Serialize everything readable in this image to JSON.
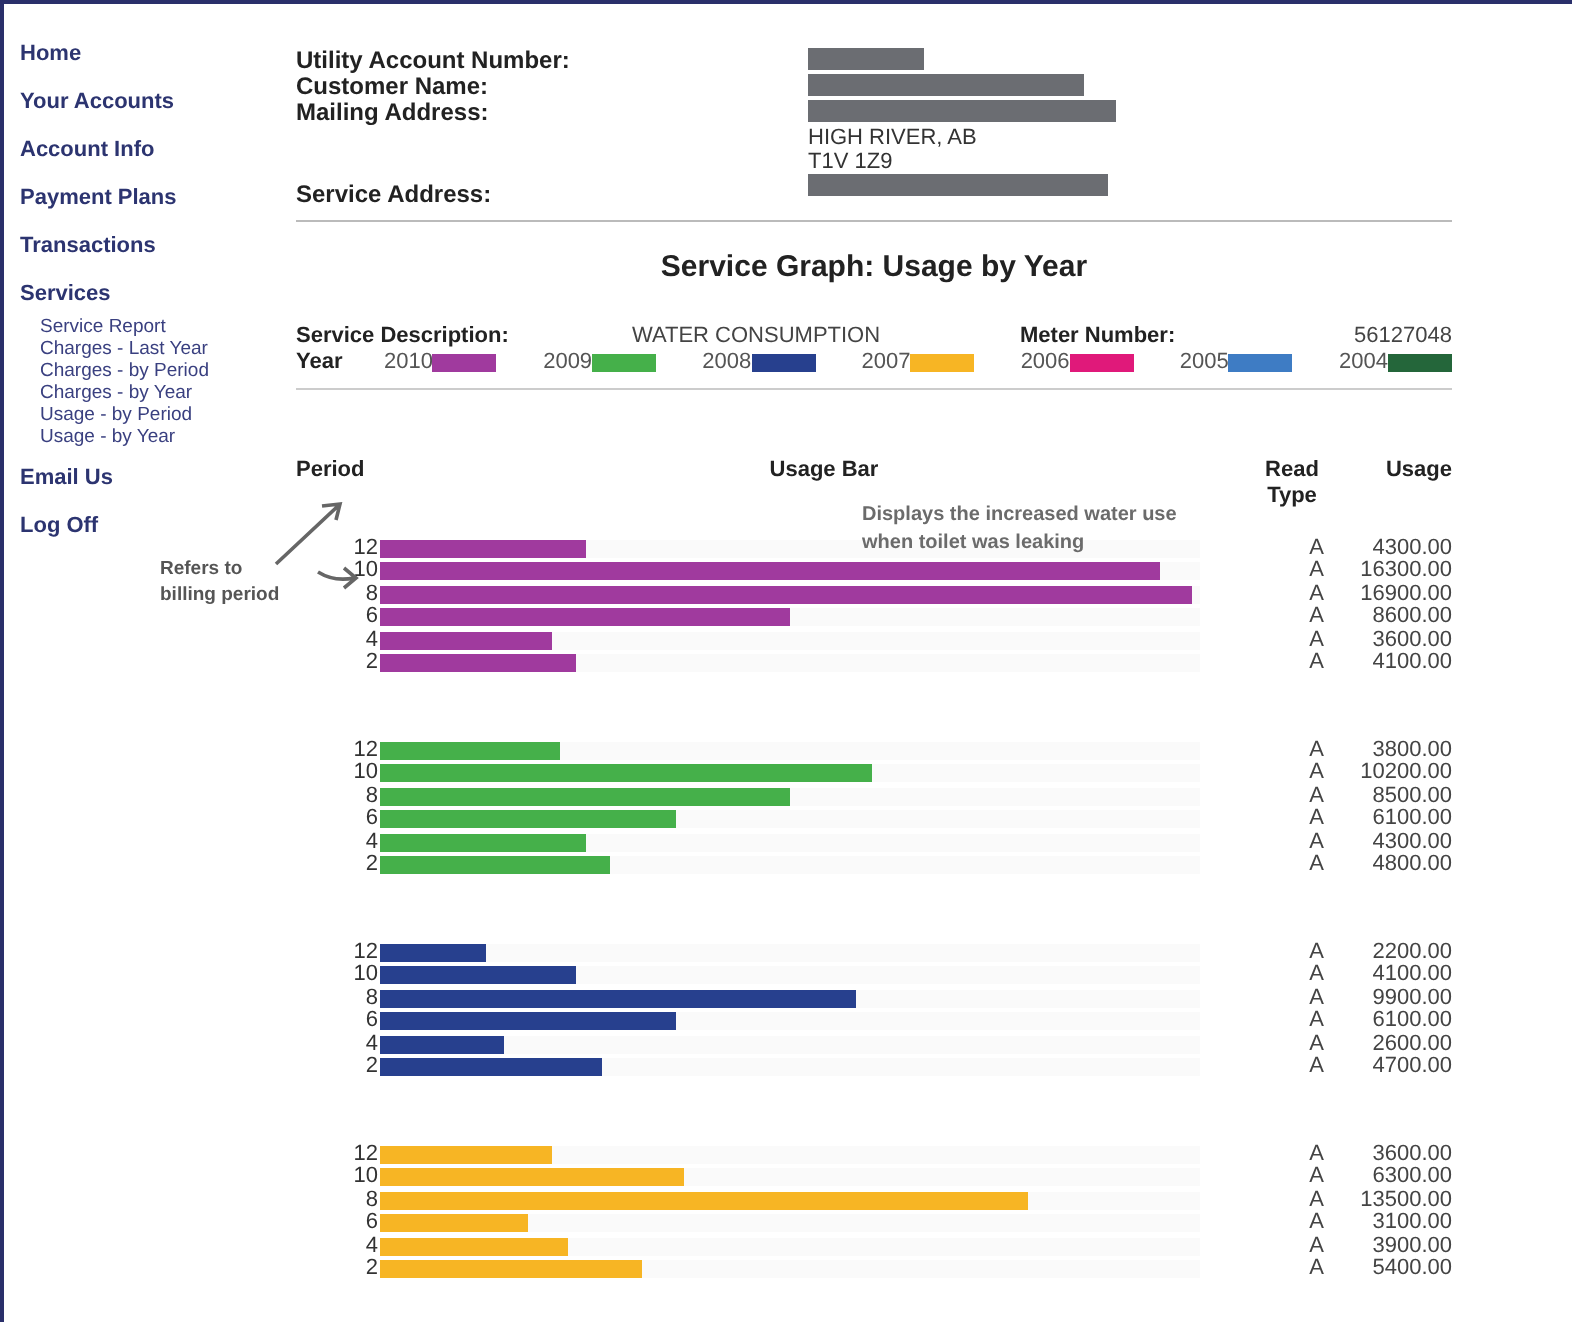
{
  "sidebar": {
    "items": [
      {
        "label": "Home"
      },
      {
        "label": "Your Accounts"
      },
      {
        "label": "Account Info"
      },
      {
        "label": "Payment Plans"
      },
      {
        "label": "Transactions"
      },
      {
        "label": "Services",
        "children": [
          {
            "label": "Service Report"
          },
          {
            "label": "Charges - Last Year"
          },
          {
            "label": "Charges - by Period"
          },
          {
            "label": "Charges - by Year"
          },
          {
            "label": "Usage - by Period"
          },
          {
            "label": "Usage - by Year"
          }
        ]
      },
      {
        "label": "Email Us"
      },
      {
        "label": "Log Off"
      }
    ]
  },
  "account": {
    "fields": [
      {
        "label": "Utility Account Number:"
      },
      {
        "label": "Customer Name:"
      },
      {
        "label": "Mailing Address:",
        "lines": [
          "HIGH RIVER, AB",
          "T1V 1Z9"
        ]
      },
      {
        "label": "Service Address:"
      }
    ]
  },
  "graph": {
    "title": "Service Graph: Usage by Year",
    "service_description_label": "Service Description:",
    "service_description": "WATER CONSUMPTION",
    "meter_label": "Meter Number:",
    "meter_number": "56127048",
    "year_label": "Year",
    "legend": [
      {
        "year": "2010",
        "color": "#a03a9e"
      },
      {
        "year": "2009",
        "color": "#45b04a"
      },
      {
        "year": "2008",
        "color": "#27408e"
      },
      {
        "year": "2007",
        "color": "#f7b524"
      },
      {
        "year": "2006",
        "color": "#e0197a"
      },
      {
        "year": "2005",
        "color": "#3e7cc4"
      },
      {
        "year": "2004",
        "color": "#24663a"
      }
    ],
    "columns": [
      "Period",
      "Usage Bar",
      "Read Type",
      "Usage"
    ],
    "note": "Displays the increased water use when toilet was leaking",
    "annotation": "Refers to billing period",
    "groups": [
      {
        "color": "#a03a9e",
        "rows": [
          {
            "period": "12",
            "level": 0.25,
            "read_type": "A",
            "usage": "4300.00"
          },
          {
            "period": "10",
            "level": 0.95,
            "read_type": "A",
            "usage": "16300.00"
          },
          {
            "period": "8",
            "level": 0.99,
            "read_type": "A",
            "usage": "16900.00"
          },
          {
            "period": "6",
            "level": 0.5,
            "read_type": "A",
            "usage": "8600.00"
          },
          {
            "period": "4",
            "level": 0.21,
            "read_type": "A",
            "usage": "3600.00"
          },
          {
            "period": "2",
            "level": 0.24,
            "read_type": "A",
            "usage": "4100.00"
          }
        ]
      },
      {
        "color": "#45b04a",
        "rows": [
          {
            "period": "12",
            "level": 0.22,
            "read_type": "A",
            "usage": "3800.00"
          },
          {
            "period": "10",
            "level": 0.6,
            "read_type": "A",
            "usage": "10200.00"
          },
          {
            "period": "8",
            "level": 0.5,
            "read_type": "A",
            "usage": "8500.00"
          },
          {
            "period": "6",
            "level": 0.36,
            "read_type": "A",
            "usage": "6100.00"
          },
          {
            "period": "4",
            "level": 0.25,
            "read_type": "A",
            "usage": "4300.00"
          },
          {
            "period": "2",
            "level": 0.28,
            "read_type": "A",
            "usage": "4800.00"
          }
        ]
      },
      {
        "color": "#27408e",
        "rows": [
          {
            "period": "12",
            "level": 0.13,
            "read_type": "A",
            "usage": "2200.00"
          },
          {
            "period": "10",
            "level": 0.24,
            "read_type": "A",
            "usage": "4100.00"
          },
          {
            "period": "8",
            "level": 0.58,
            "read_type": "A",
            "usage": "9900.00"
          },
          {
            "period": "6",
            "level": 0.36,
            "read_type": "A",
            "usage": "6100.00"
          },
          {
            "period": "4",
            "level": 0.15,
            "read_type": "A",
            "usage": "2600.00"
          },
          {
            "period": "2",
            "level": 0.27,
            "read_type": "A",
            "usage": "4700.00"
          }
        ]
      },
      {
        "color": "#f7b524",
        "rows": [
          {
            "period": "12",
            "level": 0.21,
            "read_type": "A",
            "usage": "3600.00"
          },
          {
            "period": "10",
            "level": 0.37,
            "read_type": "A",
            "usage": "6300.00"
          },
          {
            "period": "8",
            "level": 0.79,
            "read_type": "A",
            "usage": "13500.00"
          },
          {
            "period": "6",
            "level": 0.18,
            "read_type": "A",
            "usage": "3100.00"
          },
          {
            "period": "4",
            "level": 0.23,
            "read_type": "A",
            "usage": "3900.00"
          },
          {
            "period": "2",
            "level": 0.32,
            "read_type": "A",
            "usage": "5400.00"
          }
        ]
      }
    ]
  }
}
